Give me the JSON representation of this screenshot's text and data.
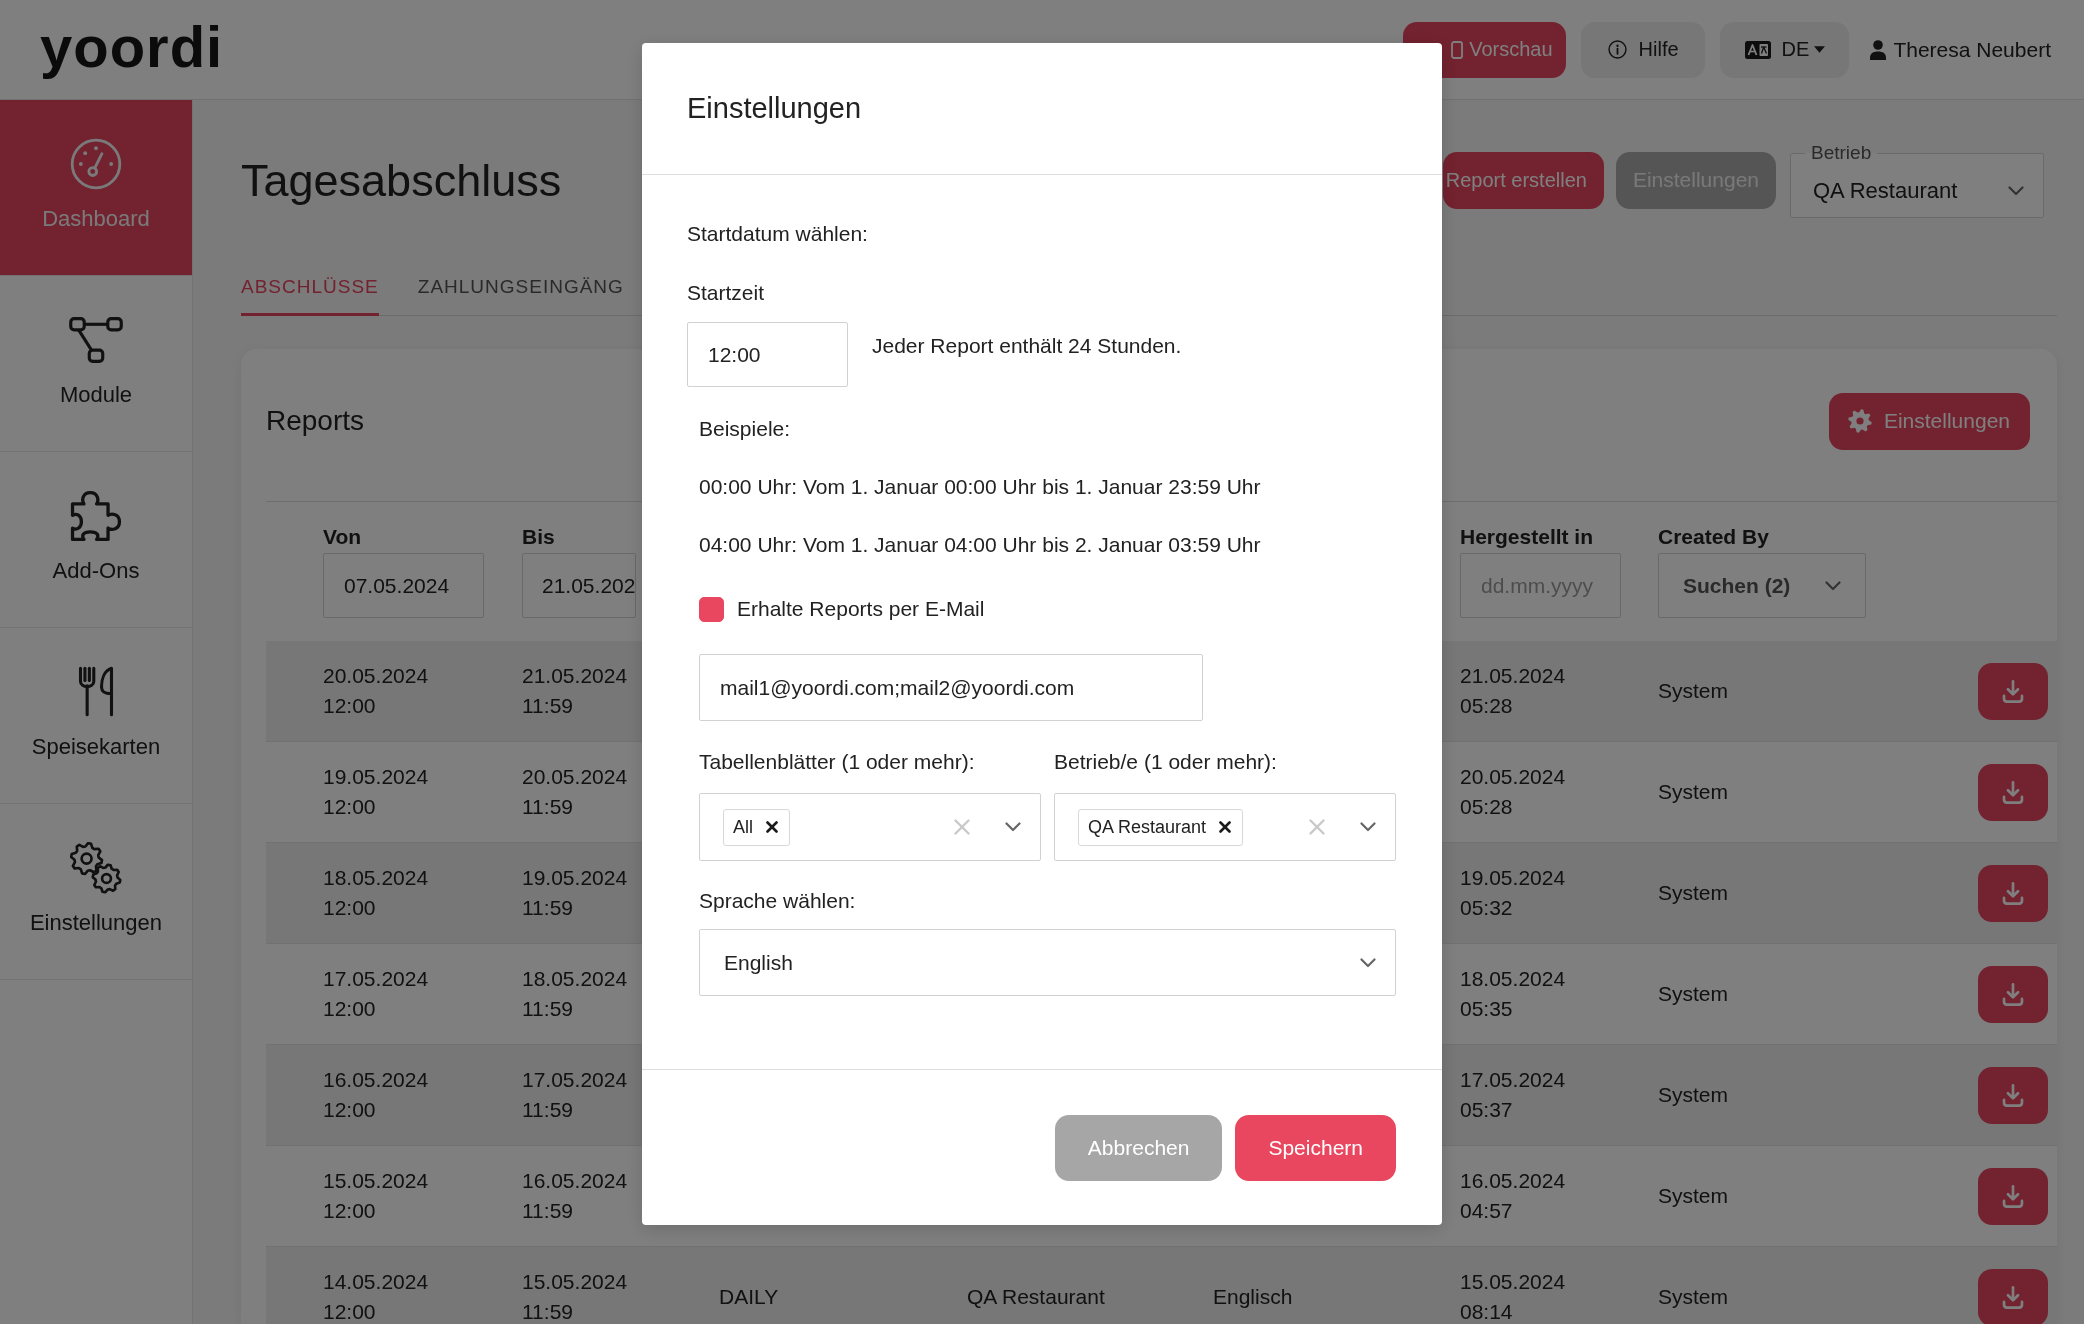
{
  "header": {
    "logo": "yoordi",
    "preview_button": "Vorschau",
    "help_button": "Hilfe",
    "language_menu": "DE",
    "user_name": "Theresa Neubert"
  },
  "sidebar": {
    "items": [
      {
        "label": "Dashboard",
        "selected": true
      },
      {
        "label": "Module",
        "selected": false
      },
      {
        "label": "Add-Ons",
        "selected": false
      },
      {
        "label": "Speisekarten",
        "selected": false
      },
      {
        "label": "Einstellungen",
        "selected": false
      }
    ]
  },
  "page": {
    "title": "Tagesabschluss",
    "create_report_button": "Report erstellen",
    "settings_button": "Einstellungen",
    "business_select": {
      "label": "Betrieb",
      "value": "QA Restaurant"
    },
    "tabs": [
      {
        "label": "ABSCHLÜSSE",
        "selected": true
      },
      {
        "label": "ZAHLUNGSEINGÄNG",
        "selected": false
      }
    ]
  },
  "reports": {
    "title": "Reports",
    "settings_button": "Einstellungen",
    "filters": {
      "von": {
        "label": "Von",
        "value": "07.05.2024"
      },
      "bis": {
        "label": "Bis",
        "value": "21.05.202"
      },
      "hergestellt_in": {
        "label": "Hergestellt in",
        "placeholder": "dd.mm.yyyy"
      },
      "created_by": {
        "label": "Created By",
        "value": "Suchen (2)"
      }
    },
    "rows": [
      {
        "von": "20.05.2024 12:00",
        "bis": "21.05.2024 11:59",
        "hergestellt_in": "21.05.2024 05:28",
        "created_by": "System"
      },
      {
        "von": "19.05.2024 12:00",
        "bis": "20.05.2024 11:59",
        "hergestellt_in": "20.05.2024 05:28",
        "created_by": "System"
      },
      {
        "von": "18.05.2024 12:00",
        "bis": "19.05.2024 11:59",
        "hergestellt_in": "19.05.2024 05:32",
        "created_by": "System"
      },
      {
        "von": "17.05.2024 12:00",
        "bis": "18.05.2024 11:59",
        "hergestellt_in": "18.05.2024 05:35",
        "created_by": "System"
      },
      {
        "von": "16.05.2024 12:00",
        "bis": "17.05.2024 11:59",
        "hergestellt_in": "17.05.2024 05:37",
        "created_by": "System"
      },
      {
        "von": "15.05.2024 12:00",
        "bis": "16.05.2024 11:59",
        "hergestellt_in": "16.05.2024 04:57",
        "created_by": "System"
      },
      {
        "von": "14.05.2024 12:00",
        "bis": "15.05.2024 11:59",
        "column_3": "DAILY",
        "column_4": "QA Restaurant",
        "column_5": "Englisch",
        "hergestellt_in": "15.05.2024 08:14",
        "created_by": "System"
      }
    ]
  },
  "dialog": {
    "title": "Einstellungen",
    "start_label": "Startdatum wählen:",
    "time_label": "Startzeit",
    "time_value": "12:00",
    "time_hint": "Jeder Report enthält 24 Stunden.",
    "examples_title": "Beispiele:",
    "examples": [
      "00:00 Uhr: Vom 1. Januar 00:00 Uhr bis 1. Januar 23:59 Uhr",
      "04:00 Uhr: Vom 1. Januar 04:00 Uhr bis 2. Januar 03:59 Uhr"
    ],
    "email_option": {
      "label": "Erhalte Reports per E-Mail",
      "checked": true
    },
    "email_value": "mail1@yoordi.com;mail2@yoordi.com",
    "sheets": {
      "label": "Tabellenblätter (1 oder mehr):",
      "tags": [
        "All"
      ]
    },
    "businesses": {
      "label": "Betrieb/e (1 oder mehr):",
      "tags": [
        "QA Restaurant"
      ]
    },
    "language": {
      "label": "Sprache wählen:",
      "value": "English"
    },
    "cancel_button": "Abbrechen",
    "save_button": "Speichern"
  }
}
